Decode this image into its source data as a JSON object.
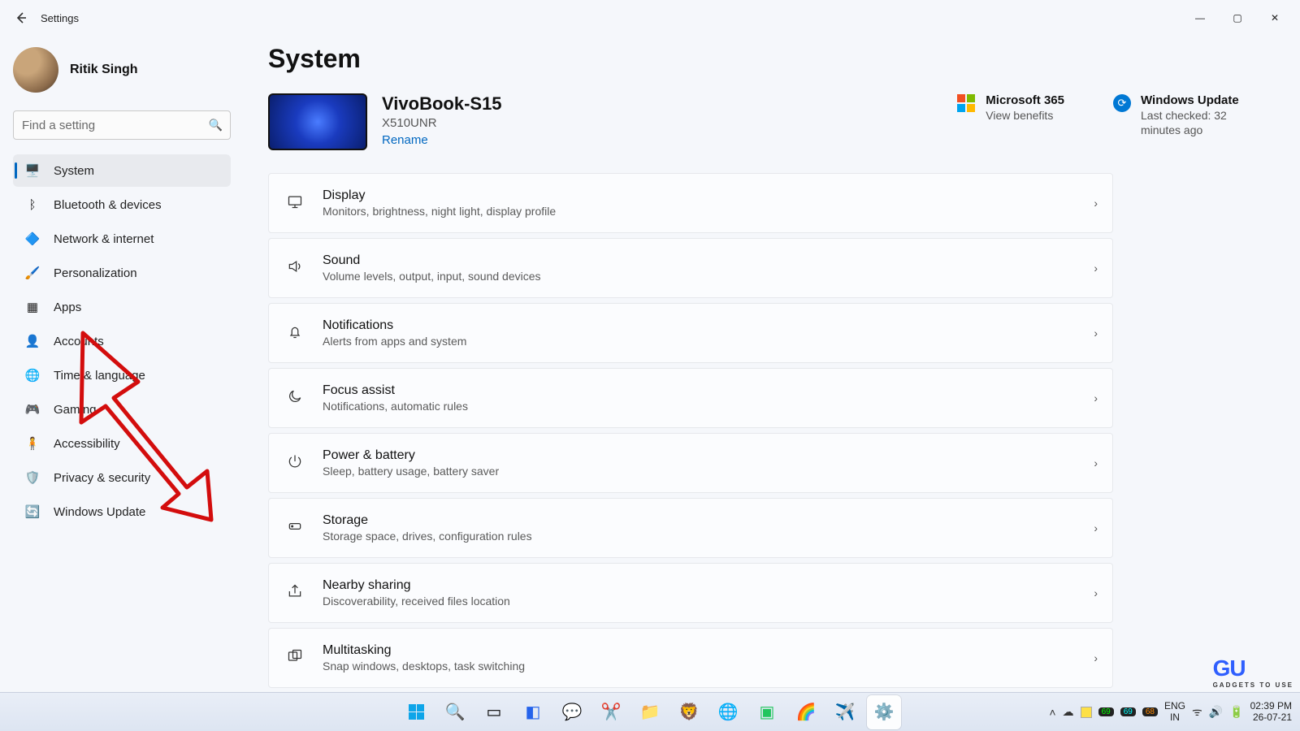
{
  "window": {
    "title": "Settings",
    "min": "—",
    "max": "▢",
    "close": "✕"
  },
  "user": {
    "name": "Ritik Singh"
  },
  "search": {
    "placeholder": "Find a setting"
  },
  "sidebar": {
    "items": [
      {
        "icon": "🖥️",
        "label": "System",
        "active": true
      },
      {
        "icon": "ᛒ",
        "label": "Bluetooth & devices"
      },
      {
        "icon": "🔷",
        "label": "Network & internet"
      },
      {
        "icon": "🖌️",
        "label": "Personalization"
      },
      {
        "icon": "▦",
        "label": "Apps"
      },
      {
        "icon": "👤",
        "label": "Accounts"
      },
      {
        "icon": "🌐",
        "label": "Time & language"
      },
      {
        "icon": "🎮",
        "label": "Gaming"
      },
      {
        "icon": "🧍",
        "label": "Accessibility"
      },
      {
        "icon": "🛡️",
        "label": "Privacy & security"
      },
      {
        "icon": "🔄",
        "label": "Windows Update"
      }
    ]
  },
  "page": {
    "title": "System",
    "device": {
      "name": "VivoBook-S15",
      "model": "X510UNR",
      "rename": "Rename"
    },
    "tiles": {
      "m365": {
        "title": "Microsoft 365",
        "sub": "View benefits"
      },
      "wu": {
        "title": "Windows Update",
        "sub": "Last checked: 32 minutes ago"
      }
    },
    "list": [
      {
        "icon": "display",
        "title": "Display",
        "sub": "Monitors, brightness, night light, display profile"
      },
      {
        "icon": "sound",
        "title": "Sound",
        "sub": "Volume levels, output, input, sound devices"
      },
      {
        "icon": "bell",
        "title": "Notifications",
        "sub": "Alerts from apps and system"
      },
      {
        "icon": "moon",
        "title": "Focus assist",
        "sub": "Notifications, automatic rules"
      },
      {
        "icon": "power",
        "title": "Power & battery",
        "sub": "Sleep, battery usage, battery saver"
      },
      {
        "icon": "storage",
        "title": "Storage",
        "sub": "Storage space, drives, configuration rules"
      },
      {
        "icon": "share",
        "title": "Nearby sharing",
        "sub": "Discoverability, received files location"
      },
      {
        "icon": "multi",
        "title": "Multitasking",
        "sub": "Snap windows, desktops, task switching"
      }
    ]
  },
  "taskbar": {
    "tray": {
      "lang1": "ENG",
      "lang2": "IN",
      "time": "02:39 PM",
      "date": "26-07-21"
    }
  },
  "chevron": "›",
  "watermark": {
    "big": "GU",
    "small": "GADGETS TO USE"
  }
}
